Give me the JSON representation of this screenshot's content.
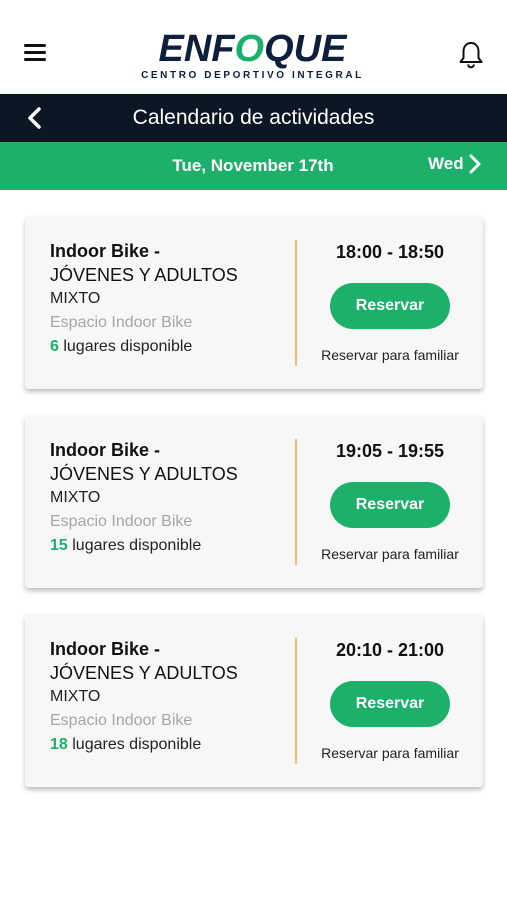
{
  "header": {
    "logo_text": "ENFOQUE",
    "logo_subtitle": "CENTRO DEPORTIVO INTEGRAL"
  },
  "titlebar": {
    "title": "Calendario de actividades"
  },
  "datebar": {
    "current": "Tue, November 17th",
    "next": "Wed"
  },
  "colors": {
    "brand_green": "#1cb06b",
    "navy": "#0c1726",
    "divider": "#f3c06b"
  },
  "activities": [
    {
      "name": "Indoor Bike -",
      "group": "JÓVENES Y ADULTOS",
      "mode": "MIXTO",
      "space": "Espacio Indoor Bike",
      "spots": "6",
      "spots_label": " lugares disponible",
      "time": "18:00 - 18:50",
      "reserve_label": "Reservar",
      "family_label": "Reservar para familiar"
    },
    {
      "name": "Indoor Bike -",
      "group": "JÓVENES Y ADULTOS",
      "mode": "MIXTO",
      "space": "Espacio Indoor Bike",
      "spots": "15",
      "spots_label": " lugares disponible",
      "time": "19:05 - 19:55",
      "reserve_label": "Reservar",
      "family_label": "Reservar para familiar"
    },
    {
      "name": "Indoor Bike -",
      "group": "JÓVENES Y ADULTOS",
      "mode": "MIXTO",
      "space": "Espacio Indoor Bike",
      "spots": "18",
      "spots_label": " lugares disponible",
      "time": "20:10 - 21:00",
      "reserve_label": "Reservar",
      "family_label": "Reservar para familiar"
    }
  ]
}
